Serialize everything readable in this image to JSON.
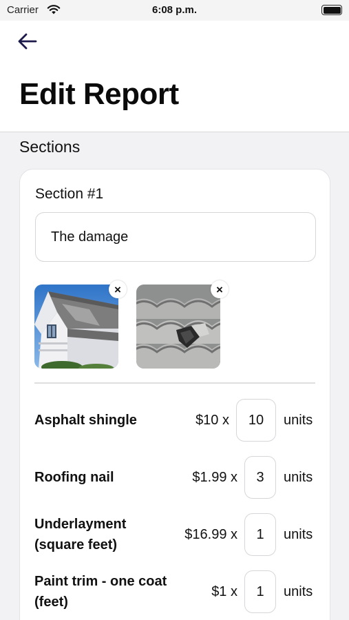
{
  "status_bar": {
    "carrier": "Carrier",
    "time": "6:08 p.m."
  },
  "header": {
    "back_icon": "arrow-left-icon",
    "title": "Edit Report"
  },
  "sections_label": "Sections",
  "section": {
    "title": "Section #1",
    "name_value": "The damage",
    "photos": [
      {
        "subject": "house-with-damaged-roof-photo",
        "remove_icon": "close-icon"
      },
      {
        "subject": "broken-roof-tiles-photo",
        "remove_icon": "close-icon"
      }
    ],
    "remove_glyph": "×",
    "line_items": [
      {
        "name": "Asphalt shingle",
        "price": "$10 x",
        "quantity": "10",
        "unit": "units"
      },
      {
        "name": "Roofing nail",
        "price": "$1.99 x",
        "quantity": "3",
        "unit": "units"
      },
      {
        "name_line1": "Underlayment",
        "name_line2": "(square feet)",
        "price": "$16.99 x",
        "quantity": "1",
        "unit": "units"
      },
      {
        "name_line1": "Paint trim - one coat",
        "name_line2": "(feet)",
        "price": "$1 x",
        "quantity": "1",
        "unit": "units"
      }
    ]
  },
  "colors": {
    "accent": "#1c1a4a",
    "background": "#f2f2f4",
    "card": "#ffffff",
    "border": "#d6d6d9"
  }
}
